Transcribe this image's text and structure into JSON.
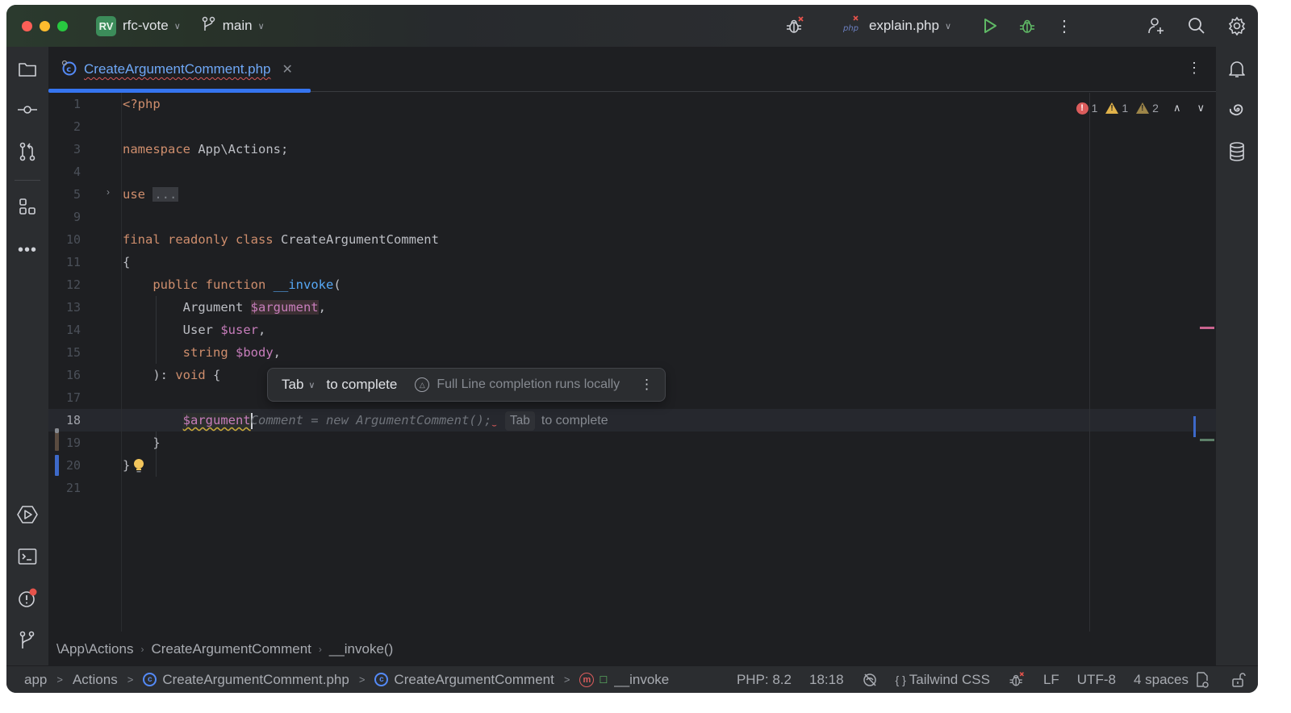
{
  "titlebar": {
    "project_initials": "RV",
    "project_name": "rfc-vote",
    "branch": "main",
    "run_config": "explain.php"
  },
  "tabs": [
    {
      "label": "CreateArgumentComment.php",
      "active": true,
      "has_error": true
    }
  ],
  "inspections": {
    "errors": "1",
    "warnings": "1",
    "weak_warnings": "2"
  },
  "gutter": {
    "line_numbers": [
      "1",
      "2",
      "3",
      "4",
      "5",
      "9",
      "10",
      "11",
      "12",
      "13",
      "14",
      "15",
      "16",
      "17",
      "18",
      "19",
      "20",
      "21"
    ]
  },
  "code": {
    "l1": "<?php",
    "l3_kw": "namespace",
    "l3_rest": " App\\Actions;",
    "l5_kw": "use",
    "l5_fold": "...",
    "l10_kw": "final readonly class",
    "l10_rest": " CreateArgumentComment",
    "l11": "{",
    "l12_kw": "public function",
    "l12_fn": "__invoke",
    "l12_rest": "(",
    "l13_type": "Argument",
    "l13_var": "$argument",
    "l13_rest": ",",
    "l14_type": "User",
    "l14_var": "$user",
    "l14_rest": ",",
    "l15_type": "string",
    "l15_var": "$body",
    "l15_rest": ",",
    "l16_pre": "): ",
    "l16_kw": "void",
    "l16_rest": " {",
    "l18_typed": "$argument",
    "l18_ghost": "Comment = new ArgumentComment();",
    "l18_hint_key": "Tab",
    "l18_hint_text": "to complete",
    "l19": "}",
    "l20": "}"
  },
  "completion_popup": {
    "key": "Tab",
    "action": "to complete",
    "info": "Full Line completion runs locally"
  },
  "breadcrumbs": [
    "\\App\\Actions",
    "CreateArgumentComment",
    "__invoke()"
  ],
  "statusbar": {
    "path": [
      "app",
      "Actions",
      "CreateArgumentComment.php",
      "CreateArgumentComment",
      "__invoke"
    ],
    "php_version": "PHP: 8.2",
    "cursor": "18:18",
    "framework": "Tailwind CSS",
    "line_ending": "LF",
    "encoding": "UTF-8",
    "indent": "4 spaces"
  },
  "colors": {
    "accent": "#3574f0",
    "error": "#db5c5c",
    "warning": "#e0b24a",
    "run_green": "#5fb865"
  }
}
